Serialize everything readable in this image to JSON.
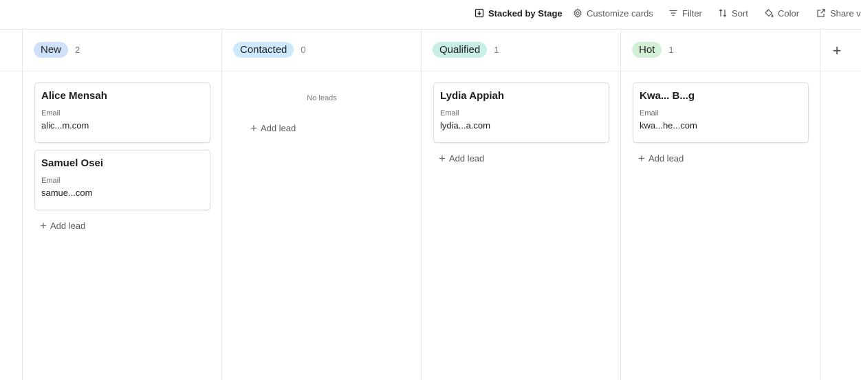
{
  "toolbar": {
    "stacked_label": "Stacked by Stage",
    "customize_label": "Customize cards",
    "filter_label": "Filter",
    "sort_label": "Sort",
    "color_label": "Color",
    "share_label": "Share vi"
  },
  "columns": [
    {
      "name": "New",
      "count": "2",
      "color": "#cfe0fb",
      "cards": [
        {
          "name": "Alice Mensah",
          "field_label": "Email",
          "field_value": "alic...m.com"
        },
        {
          "name": "Samuel Osei",
          "field_label": "Email",
          "field_value": "samue...com"
        }
      ],
      "add_label": "Add lead"
    },
    {
      "name": "Contacted",
      "count": "0",
      "color": "#cde9fb",
      "empty_text": "No leads",
      "add_label": "Add lead"
    },
    {
      "name": "Qualified",
      "count": "1",
      "color": "#c9ede7",
      "cards": [
        {
          "name": "Lydia Appiah",
          "field_label": "Email",
          "field_value": "lydia...a.com"
        }
      ],
      "add_label": "Add lead"
    },
    {
      "name": "Hot",
      "count": "1",
      "color": "#d3f0d6",
      "cards": [
        {
          "name": "Kwa... B...g",
          "field_label": "Email",
          "field_value": "kwa...he...com"
        }
      ],
      "add_label": "Add lead"
    }
  ],
  "add_column_icon": "+"
}
